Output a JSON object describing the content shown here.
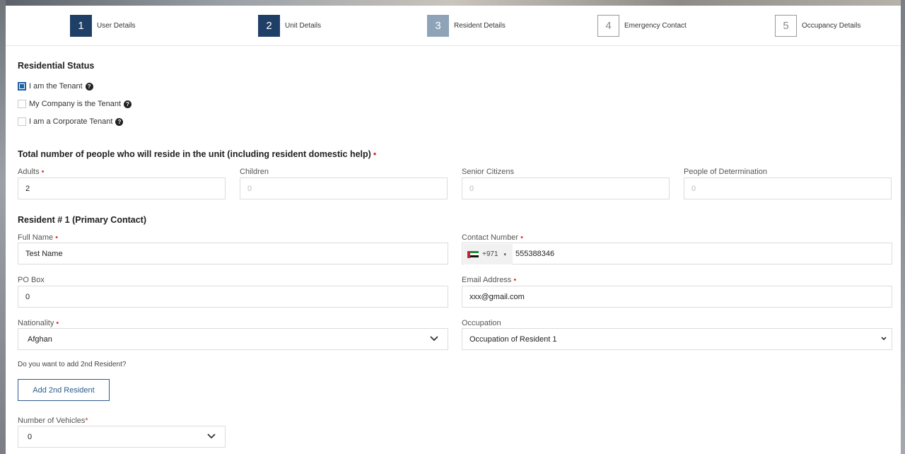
{
  "stepper": [
    {
      "number": "1",
      "label": "User Details",
      "state": "done"
    },
    {
      "number": "2",
      "label": "Unit Details",
      "state": "done"
    },
    {
      "number": "3",
      "label": "Resident Details",
      "state": "active"
    },
    {
      "number": "4",
      "label": "Emergency Contact",
      "state": "todo"
    },
    {
      "number": "5",
      "label": "Occupancy Details",
      "state": "todo"
    }
  ],
  "residential_status": {
    "title": "Residential Status",
    "options": [
      {
        "label": "I am the Tenant",
        "checked": true
      },
      {
        "label": "My Company is the Tenant",
        "checked": false
      },
      {
        "label": "I am a Corporate Tenant",
        "checked": false
      }
    ],
    "help_glyph": "?"
  },
  "occupants": {
    "title": "Total number of people who will reside in the unit (including resident domestic help)",
    "required_mark": "•",
    "adults": {
      "label": "Adults",
      "value": "2"
    },
    "children": {
      "label": "Children",
      "value": "0"
    },
    "seniors": {
      "label": "Senior Citizens",
      "value": "0"
    },
    "determination": {
      "label": "People of Determination",
      "value": "0"
    }
  },
  "resident1": {
    "title": "Resident # 1 (Primary Contact)",
    "full_name": {
      "label": "Full Name",
      "value": "Test Name"
    },
    "contact": {
      "label": "Contact Number",
      "prefix": "+971",
      "value": "555388346"
    },
    "po_box": {
      "label": "PO Box",
      "value": "0"
    },
    "email": {
      "label": "Email Address",
      "value": "xxx@gmail.com"
    },
    "nationality": {
      "label": "Nationality",
      "value": "Afghan"
    },
    "occupation": {
      "label": "Occupation",
      "value": "Occupation of Resident 1"
    }
  },
  "add_resident": {
    "question": "Do you want to add 2nd Resident?",
    "button_label": "Add 2nd Resident"
  },
  "vehicles": {
    "label": "Number of Vehicles",
    "required_mark": "*",
    "value": "0"
  },
  "colors": {
    "primary": "#1f3f66",
    "active_step": "#8fa3b8",
    "required": "#dd3333",
    "accent": "#2d5b8c"
  },
  "icons": {
    "caret": "▾",
    "chevron": "chevron-down-icon",
    "flag": "uae-flag-icon"
  }
}
